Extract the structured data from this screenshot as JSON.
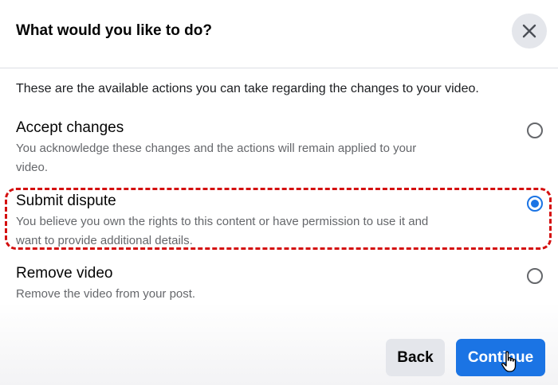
{
  "dialog": {
    "title": "What would you like to do?",
    "intro": "These are the available actions you can take regarding the changes to your video.",
    "options": [
      {
        "title": "Accept changes",
        "desc_line1": "You acknowledge these changes and the actions will remain applied to your",
        "desc_line2": "video.",
        "selected": false
      },
      {
        "title": "Submit dispute",
        "desc_line1": "You believe you own the rights to this content or have permission to use it and",
        "desc_line2": "want to provide additional details.",
        "selected": true
      },
      {
        "title": "Remove video",
        "desc_line1": "Remove the video from your post.",
        "selected": false
      }
    ],
    "buttons": {
      "back": "Back",
      "continue": "Continue"
    }
  },
  "colors": {
    "accent": "#1b74e4",
    "highlight": "#d40f0f",
    "secondary_text": "#65676b",
    "button_gray": "#e4e6eb"
  },
  "icons": {
    "close": "close-icon",
    "cursor": "hand-cursor-icon"
  }
}
